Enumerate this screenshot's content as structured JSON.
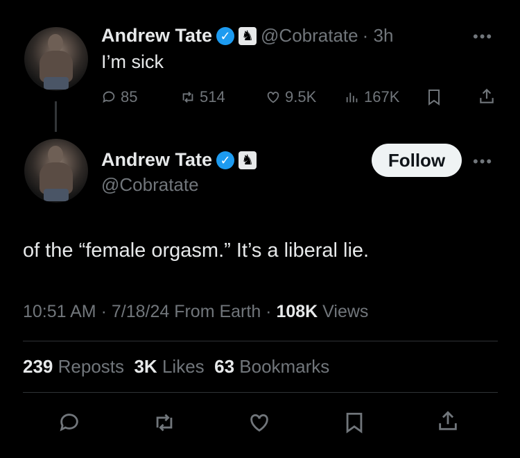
{
  "parent_tweet": {
    "author_name": "Andrew Tate",
    "handle": "@Cobratate",
    "time": "· 3h",
    "text": "I’m sick",
    "replies": "85",
    "reposts": "514",
    "likes": "9.5K",
    "views": "167K",
    "icons": [
      "reply-icon",
      "repost-icon",
      "like-icon",
      "views-icon",
      "bookmark-icon",
      "share-icon"
    ]
  },
  "main_tweet": {
    "author_name": "Andrew Tate",
    "handle": "@Cobratate",
    "follow_label": "Follow",
    "text": "of the “female orgasm.” It’s a liberal lie.",
    "timestamp": "10:51 AM · 7/18/24 From Earth ·",
    "views_count": "108K",
    "views_label": "Views",
    "reposts_count": "239",
    "reposts_label": "Reposts",
    "likes_count": "3K",
    "likes_label": "Likes",
    "bookmarks_count": "63",
    "bookmarks_label": "Bookmarks"
  },
  "colors": {
    "background": "#000000",
    "text": "#e7e9ea",
    "muted": "#71767b",
    "verified": "#1d9bf0",
    "divider": "#2f3336"
  }
}
